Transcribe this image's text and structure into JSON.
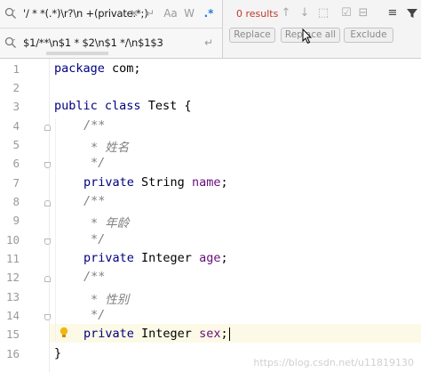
{
  "find": {
    "query": "'/ * *(.*)\\r?\\n +(private.*;)",
    "icons": [
      "close-icon",
      "newline-icon",
      "match-case-icon",
      "words-icon",
      "regex-icon"
    ],
    "icon_glyphs": [
      "✕",
      "↵",
      "Aa",
      "W",
      ".*"
    ]
  },
  "replace": {
    "value": "$1/**\\n$1 * $2\\n$1 */\\n$1$3"
  },
  "toolbar": {
    "results": "0 results",
    "replace_label": "Replace",
    "replace_all_label": "Replace all",
    "exclude_label": "Exclude"
  },
  "editor": {
    "lines": [
      {
        "n": "1"
      },
      {
        "n": "2"
      },
      {
        "n": "3"
      },
      {
        "n": "4"
      },
      {
        "n": "5"
      },
      {
        "n": "6"
      },
      {
        "n": "7"
      },
      {
        "n": "8"
      },
      {
        "n": "9"
      },
      {
        "n": "10"
      },
      {
        "n": "11"
      },
      {
        "n": "12"
      },
      {
        "n": "13"
      },
      {
        "n": "14"
      },
      {
        "n": "15"
      },
      {
        "n": "16"
      }
    ],
    "code": {
      "l1_kw": "package",
      "l1_rest": " com;",
      "l3_kw1": "public",
      "l3_kw2": "class",
      "l3_rest": " Test {",
      "c_open": "/**",
      "c1": "* 姓名",
      "c_close": "*/",
      "l7_kw": "private",
      "l7_type": " String ",
      "l7_field": "name",
      "l7_end": ";",
      "c2": "* 年龄",
      "l11_kw": "private",
      "l11_type": " Integer ",
      "l11_field": "age",
      "l11_end": ";",
      "c3": "* 性别",
      "l15_kw": "private",
      "l15_type": " Integer ",
      "l15_field": "sex",
      "l15_end": ";",
      "l16": "}"
    },
    "watermark": "https://blog.csdn.net/u11819130"
  }
}
